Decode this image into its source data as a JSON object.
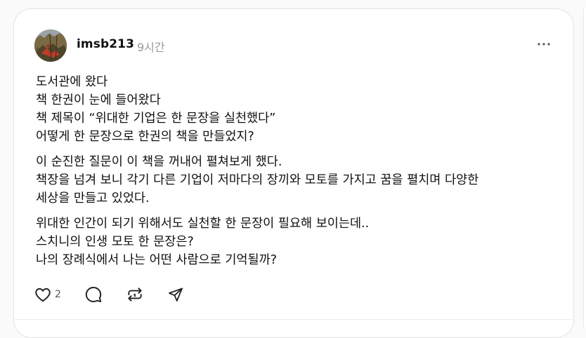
{
  "post": {
    "username": "imsb213",
    "timestamp": "9시간",
    "paragraphs": [
      "도서관에 왔다\n책 한권이 눈에 들어왔다\n책 제목이 “위대한 기업은 한 문장을 실천했다”\n어떻게 한 문장으로 한권의 책을 만들었지?",
      "이 순진한 질문이 이 책을 꺼내어 펼쳐보게 했다.\n책장을 넘겨 보니 각기 다른 기업이 저마다의 장끼와 모토를 가지고 꿈을 펼치며 다양한\n세상을 만들고 있었다.",
      "위대한 인간이 되기 위해서도 실천할 한 문장이 필요해 보이는데..\n스치니의 인생 모토 한 문장은?\n나의 장례식에서 나는 어떤 사람으로 기억될까?"
    ],
    "like_count": "2"
  },
  "icons": {
    "more": "more-horizontal-icon",
    "like": "heart-icon",
    "comment": "comment-bubble-icon",
    "repost": "repost-icon",
    "share": "send-icon"
  },
  "colors": {
    "text": "#101010",
    "muted": "#999999",
    "border": "#e3e3e3"
  }
}
